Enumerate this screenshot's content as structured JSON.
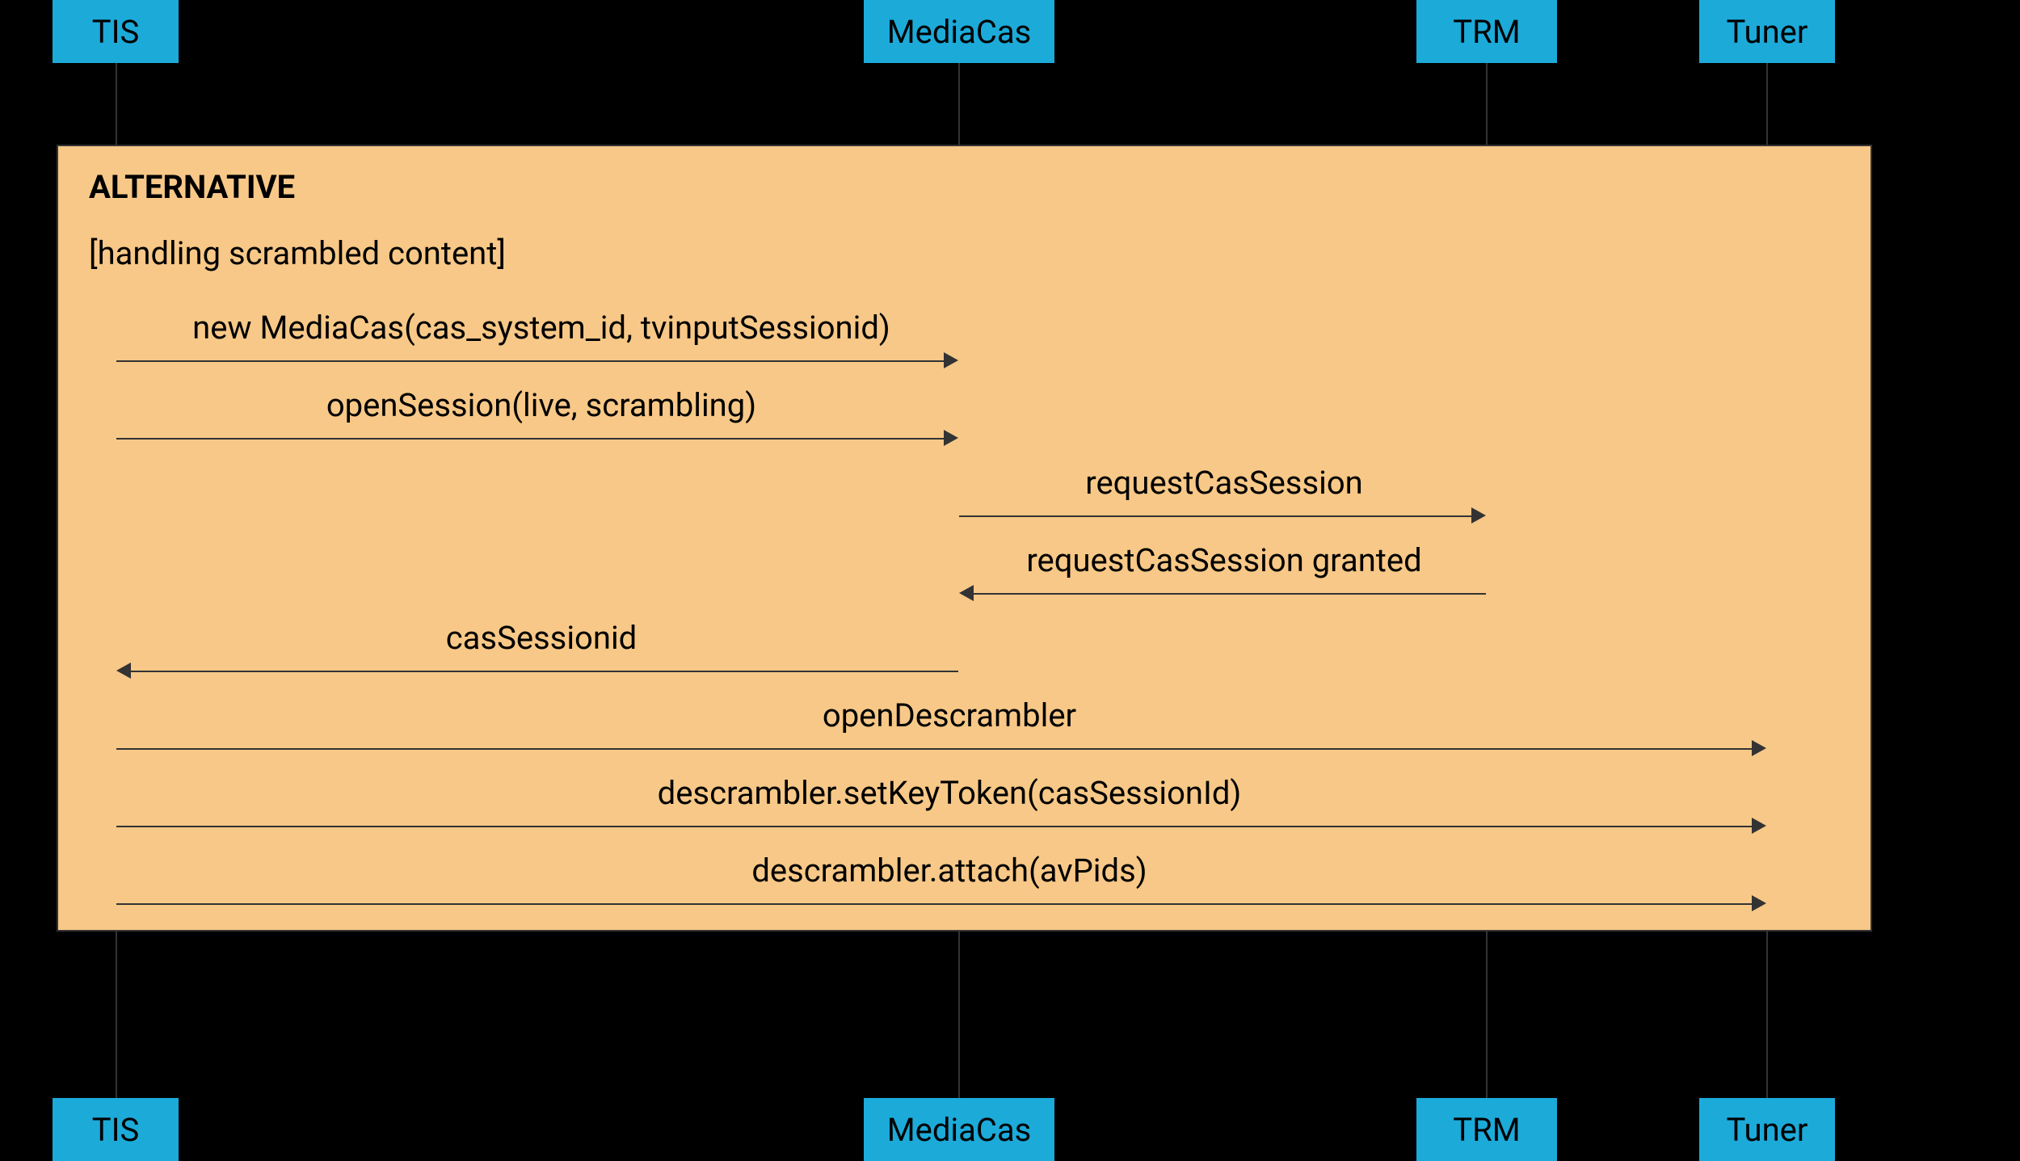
{
  "participants": [
    {
      "id": "tis",
      "label": "TIS"
    },
    {
      "id": "mediacas",
      "label": "MediaCas"
    },
    {
      "id": "trm",
      "label": "TRM"
    },
    {
      "id": "tuner",
      "label": "Tuner"
    }
  ],
  "alt_box": {
    "title": "ALTERNATIVE",
    "condition": "[handling scrambled content]"
  },
  "messages": [
    {
      "id": "msg1",
      "label": "new MediaCas(cas_system_id, tvinputSessionid)",
      "from": "tis",
      "to": "mediacas",
      "dir": "right"
    },
    {
      "id": "msg2",
      "label": "openSession(live, scrambling)",
      "from": "tis",
      "to": "mediacas",
      "dir": "right"
    },
    {
      "id": "msg3",
      "label": "requestCasSession",
      "from": "mediacas",
      "to": "trm",
      "dir": "right"
    },
    {
      "id": "msg4",
      "label": "requestCasSession granted",
      "from": "trm",
      "to": "mediacas",
      "dir": "left"
    },
    {
      "id": "msg5",
      "label": "casSessionid",
      "from": "mediacas",
      "to": "tis",
      "dir": "left"
    },
    {
      "id": "msg6",
      "label": "openDescrambler",
      "from": "tis",
      "to": "tuner",
      "dir": "right"
    },
    {
      "id": "msg7",
      "label": "descrambler.setKeyToken(casSessionId)",
      "from": "tis",
      "to": "tuner",
      "dir": "right"
    },
    {
      "id": "msg8",
      "label": "descrambler.attach(avPids)",
      "from": "tis",
      "to": "tuner",
      "dir": "right"
    }
  ],
  "colors": {
    "participant_bg": "#1caad9",
    "alt_bg": "#f7c887",
    "line": "#333333"
  }
}
